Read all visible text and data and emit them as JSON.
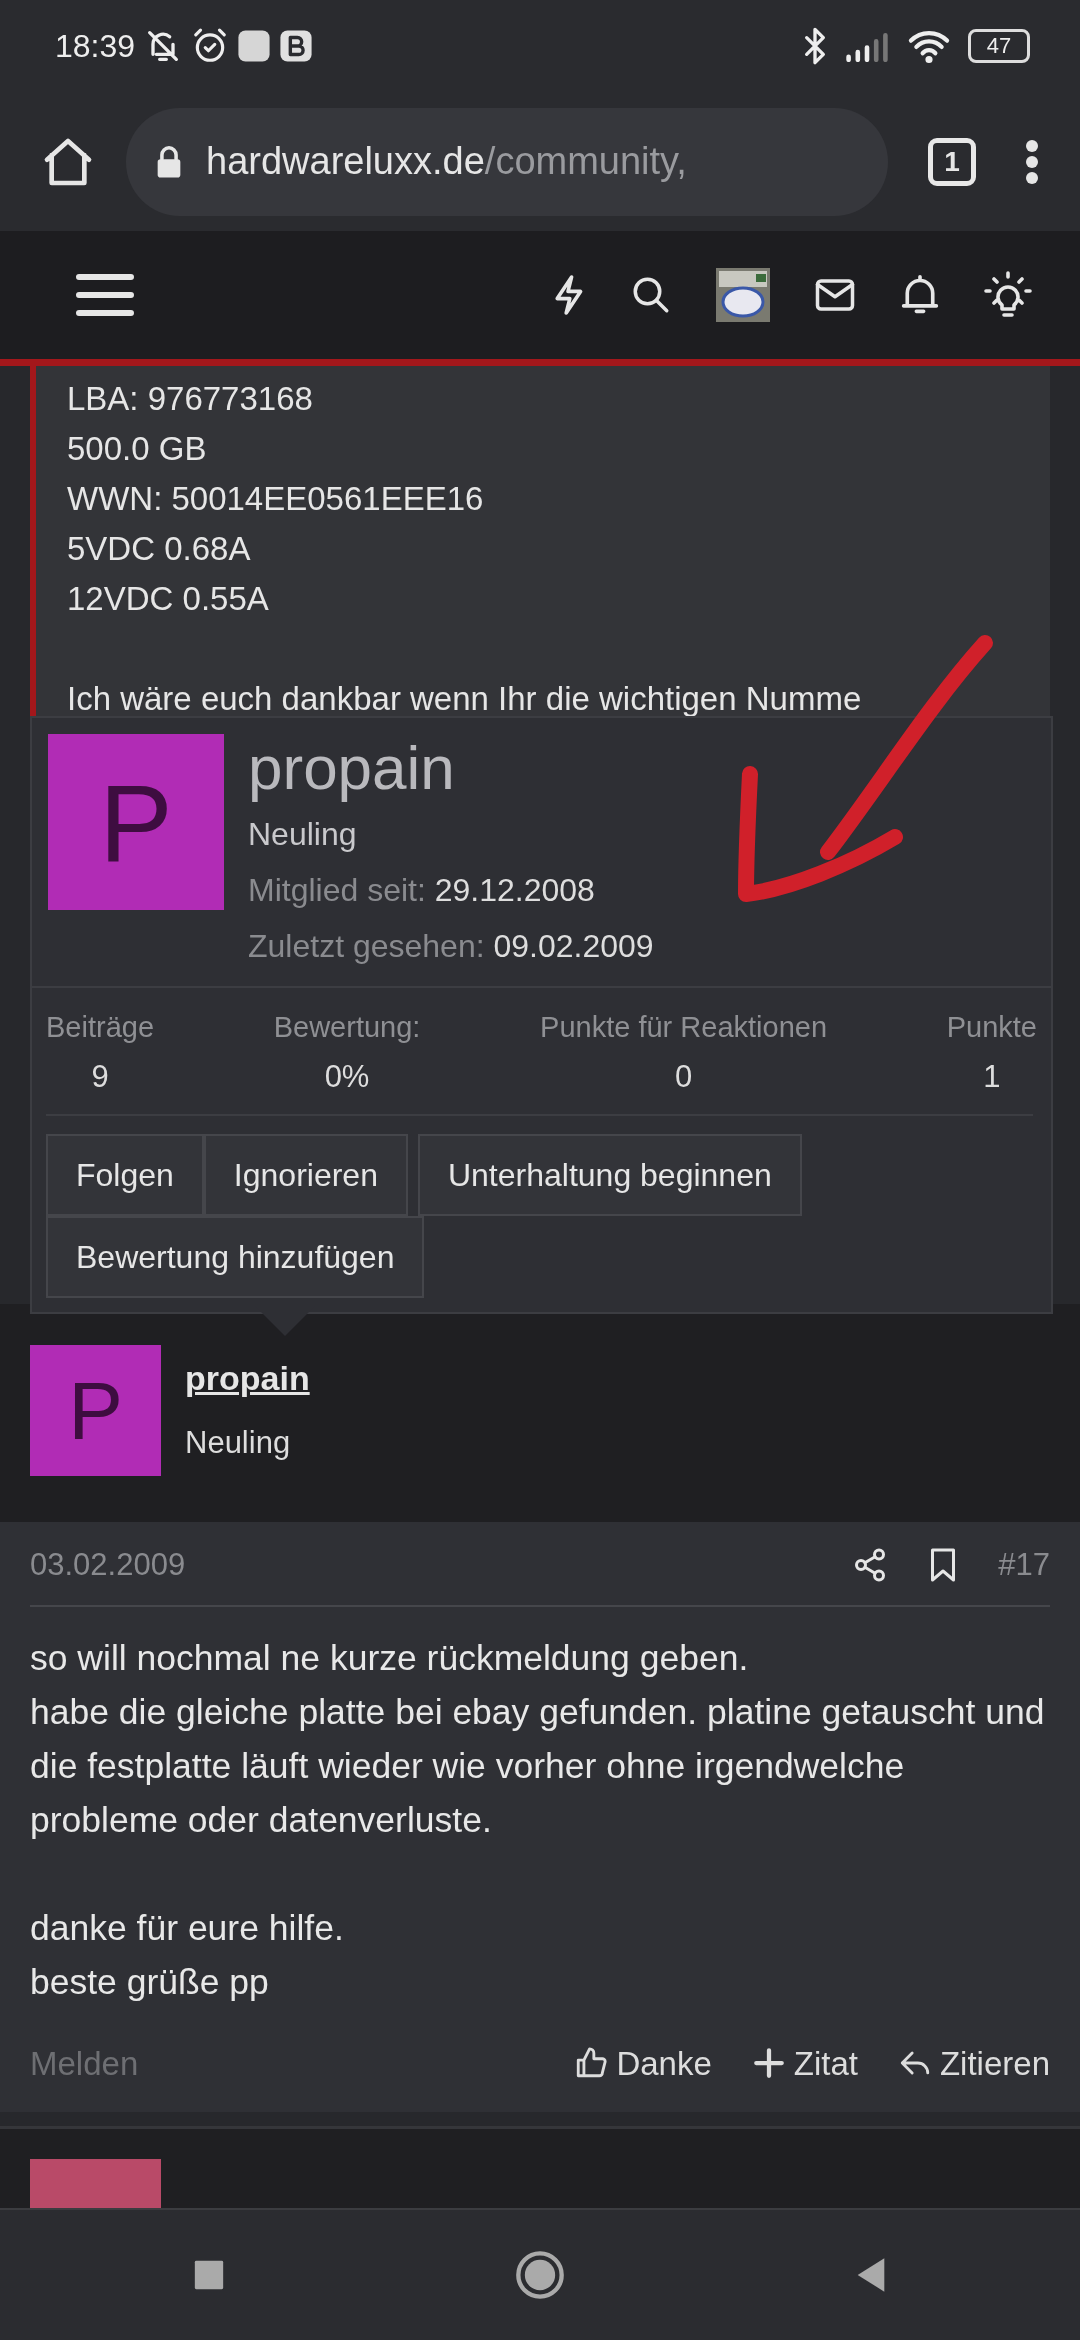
{
  "status_bar": {
    "time": "18:39",
    "battery": "47"
  },
  "browser": {
    "url_host": "hardwareluxx.de",
    "url_path": "/community,",
    "tab_count": "1"
  },
  "quote": {
    "paragraphs": [
      [
        "LBA: 976773168",
        "500.0 GB",
        "WWN: 50014EE0561EEE16",
        "5VDC 0.68A",
        "12VDC 0.55A"
      ],
      [
        "Ich wäre euch dankbar wenn Ihr die wichtigen Numme"
      ]
    ]
  },
  "member_card": {
    "avatar_letter": "P",
    "name": "propain",
    "title": "Neuling",
    "fields": [
      {
        "label": "Mitglied seit:",
        "value": "29.12.2008"
      },
      {
        "label": "Zuletzt gesehen:",
        "value": "09.02.2009"
      }
    ],
    "stats": [
      {
        "label": "Beiträge",
        "value": "9"
      },
      {
        "label": "Bewertung:",
        "value": "0%"
      },
      {
        "label": "Punkte für Reaktionen",
        "value": "0"
      },
      {
        "label": "Punkte",
        "value": "1"
      }
    ],
    "button_rows": [
      [
        "Folgen",
        "Ignorieren",
        "Unterhaltung beginnen"
      ],
      [
        "Bewertung hinzufügen"
      ]
    ]
  },
  "post": {
    "author": {
      "avatar_letter": "P",
      "name": "propain",
      "title": "Neuling"
    },
    "date": "03.02.2009",
    "number": "#17",
    "paragraphs": [
      [
        "so will nochmal ne kurze rückmeldung geben.",
        "habe die gleiche platte bei ebay gefunden. platine getauscht und die festplatte läuft wieder wie vorher ohne irgendwelche probleme oder datenverluste."
      ],
      [
        "danke für eure hilfe.",
        "beste grüße pp"
      ]
    ],
    "report": "Melden",
    "actions": [
      {
        "kind": "like",
        "label": "Danke"
      },
      {
        "kind": "add",
        "label": "Zitat"
      },
      {
        "kind": "reply",
        "label": "Zitieren"
      }
    ]
  }
}
